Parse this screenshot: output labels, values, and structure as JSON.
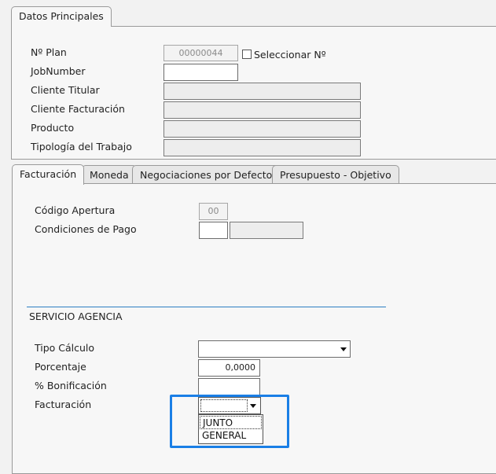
{
  "top_section": {
    "tab_label": "Datos Principales",
    "fields": {
      "nplan_label": "Nº Plan",
      "nplan_value": "00000044",
      "select_n_label": "Seleccionar Nº",
      "jobnumber_label": "JobNumber",
      "jobnumber_value": "",
      "cliente_titular_label": "Cliente Titular",
      "cliente_titular_value": "",
      "cliente_facturacion_label": "Cliente Facturación",
      "cliente_facturacion_value": "",
      "producto_label": "Producto",
      "producto_value": "",
      "tipologia_label": "Tipología del Trabajo",
      "tipologia_value": ""
    }
  },
  "tabs": [
    {
      "label": "Facturación",
      "active": true
    },
    {
      "label": "Moneda",
      "active": false
    },
    {
      "label": "Negociaciones por Defecto",
      "active": false
    },
    {
      "label": "Presupuesto - Objetivo",
      "active": false
    }
  ],
  "facturacion": {
    "codigo_apertura_label": "Código Apertura",
    "codigo_apertura_value": "00",
    "condiciones_pago_label": "Condiciones de Pago",
    "condiciones_pago_code": "",
    "condiciones_pago_desc": "",
    "section_title": "SERVICIO AGENCIA",
    "tipo_calculo_label": "Tipo Cálculo",
    "tipo_calculo_value": "",
    "porcentaje_label": "Porcentaje",
    "porcentaje_value": "0,0000",
    "bonificacion_label": "% Bonificación",
    "bonificacion_value": "",
    "facturacion_label": "Facturación",
    "facturacion_value": "",
    "facturacion_options": [
      "JUNTO",
      "GENERAL"
    ]
  },
  "colors": {
    "highlight_box": "#1a7fe6",
    "divider": "#2c7fc2"
  }
}
